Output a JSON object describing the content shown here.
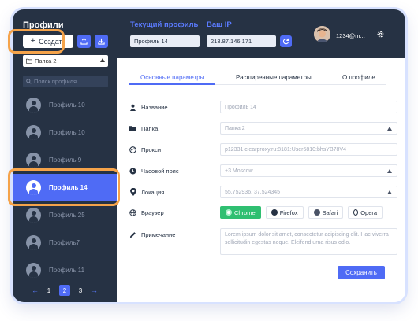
{
  "colors": {
    "sidebar_bg": "#263244",
    "accent": "#4f6bf5",
    "active_browser": "#2fbf71",
    "highlight": "#f5a34a"
  },
  "sidebar": {
    "title": "Профили",
    "create_label": "Создать",
    "folder_value": "Папка 2",
    "search_placeholder": "Поиск профиля",
    "profiles": [
      {
        "label": "Профиль 10",
        "active": false
      },
      {
        "label": "Профиль 10",
        "active": false
      },
      {
        "label": "Профиль 9",
        "active": false
      },
      {
        "label": "Профиль 14",
        "active": true
      },
      {
        "label": "Профиль 25",
        "active": false
      },
      {
        "label": "Профиль7",
        "active": false
      },
      {
        "label": "Профиль 11",
        "active": false
      }
    ],
    "pagination": {
      "pages": [
        "1",
        "2",
        "3"
      ],
      "current": "2"
    }
  },
  "header": {
    "current_profile_label": "Текущий профиль",
    "current_profile_value": "Профиль 14",
    "ip_label": "Ваш IP",
    "ip_value": "213.87.146.171",
    "user_name": "1234@m..."
  },
  "tabs": [
    {
      "label": "Основные параметры",
      "active": true
    },
    {
      "label": "Расширенные параметры",
      "active": false
    },
    {
      "label": "О профиле",
      "active": false
    }
  ],
  "form": {
    "name": {
      "label": "Название",
      "value": "Профиль 14"
    },
    "folder": {
      "label": "Папка",
      "value": "Папка 2"
    },
    "proxy": {
      "label": "Прокси",
      "value": "p12331.clearproxy.ru:8181:User5810:bhsYB78V4"
    },
    "timezone": {
      "label": "Часовой пояс",
      "value": "+3 Moscow"
    },
    "location": {
      "label": "Локация",
      "value": "55.752936, 37.524345"
    },
    "browser": {
      "label": "Браузер",
      "options": [
        "Chrome",
        "Firefox",
        "Safari",
        "Opera"
      ],
      "selected": "Chrome"
    },
    "note": {
      "label": "Примечание",
      "value": "Lorem ipsum dolor sit amet, consectetur adipiscing elit. Hac viverra sollicitudin egestas neque. Eleifend urna risus odio."
    },
    "save_label": "Сохранить"
  }
}
